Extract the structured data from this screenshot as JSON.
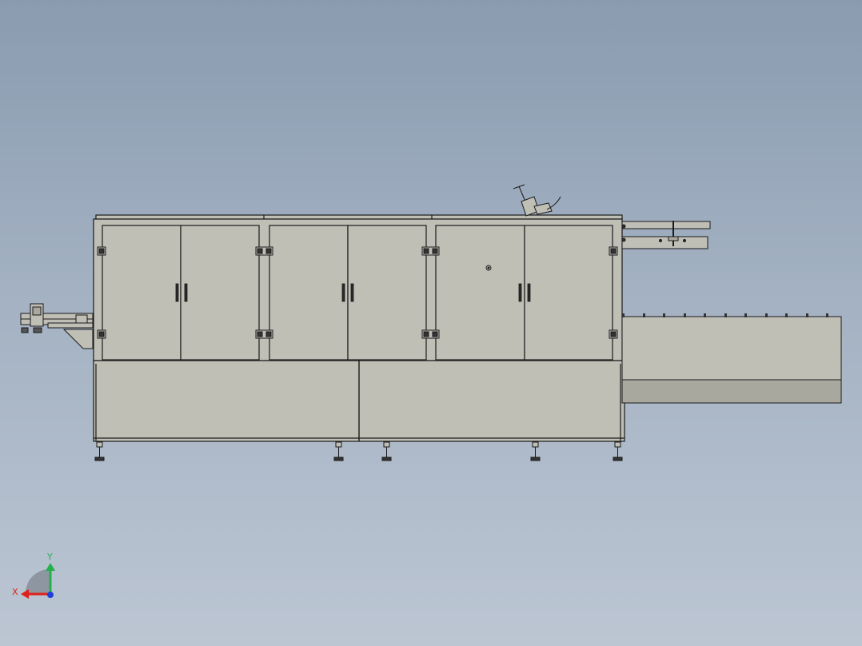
{
  "viewport": {
    "background_top": "#8a9bb0",
    "background_bottom": "#bcc6d3",
    "model_fill": "#c0bfb6",
    "model_fill_dark": "#a9a89f",
    "edge_color": "#1a1a1a"
  },
  "triad": {
    "x_label": "X",
    "y_label": "Y",
    "x_color": "#e0201b",
    "y_color": "#22b14c",
    "z_color": "#1f3fd8"
  }
}
